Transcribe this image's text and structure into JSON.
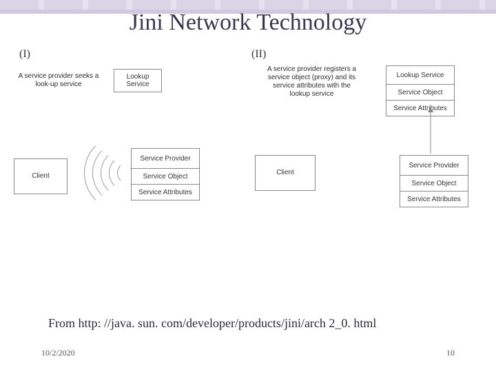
{
  "title": "Jini Network Technology",
  "panels": [
    {
      "label": "(I)",
      "seek_text": "A service provider seeks a look-up service",
      "lookup": "Lookup Service",
      "client": "Client",
      "provider": {
        "title": "Service Provider",
        "obj": "Service Object",
        "attrs": "Service Attributes"
      }
    },
    {
      "label": "(II)",
      "register_text": "A service provider registers a service object (proxy) and its service attributes with the lookup service",
      "lookup": {
        "title": "Lookup Service",
        "obj": "Service Object",
        "attrs": "Service Attributes"
      },
      "client": "Client",
      "provider": {
        "title": "Service Provider",
        "obj": "Service Object",
        "attrs": "Service Attributes"
      }
    }
  ],
  "caption": "From  http: //java. sun. com/developer/products/jini/arch 2_0. html",
  "footer": {
    "date": "10/2/2020",
    "page": "10"
  }
}
